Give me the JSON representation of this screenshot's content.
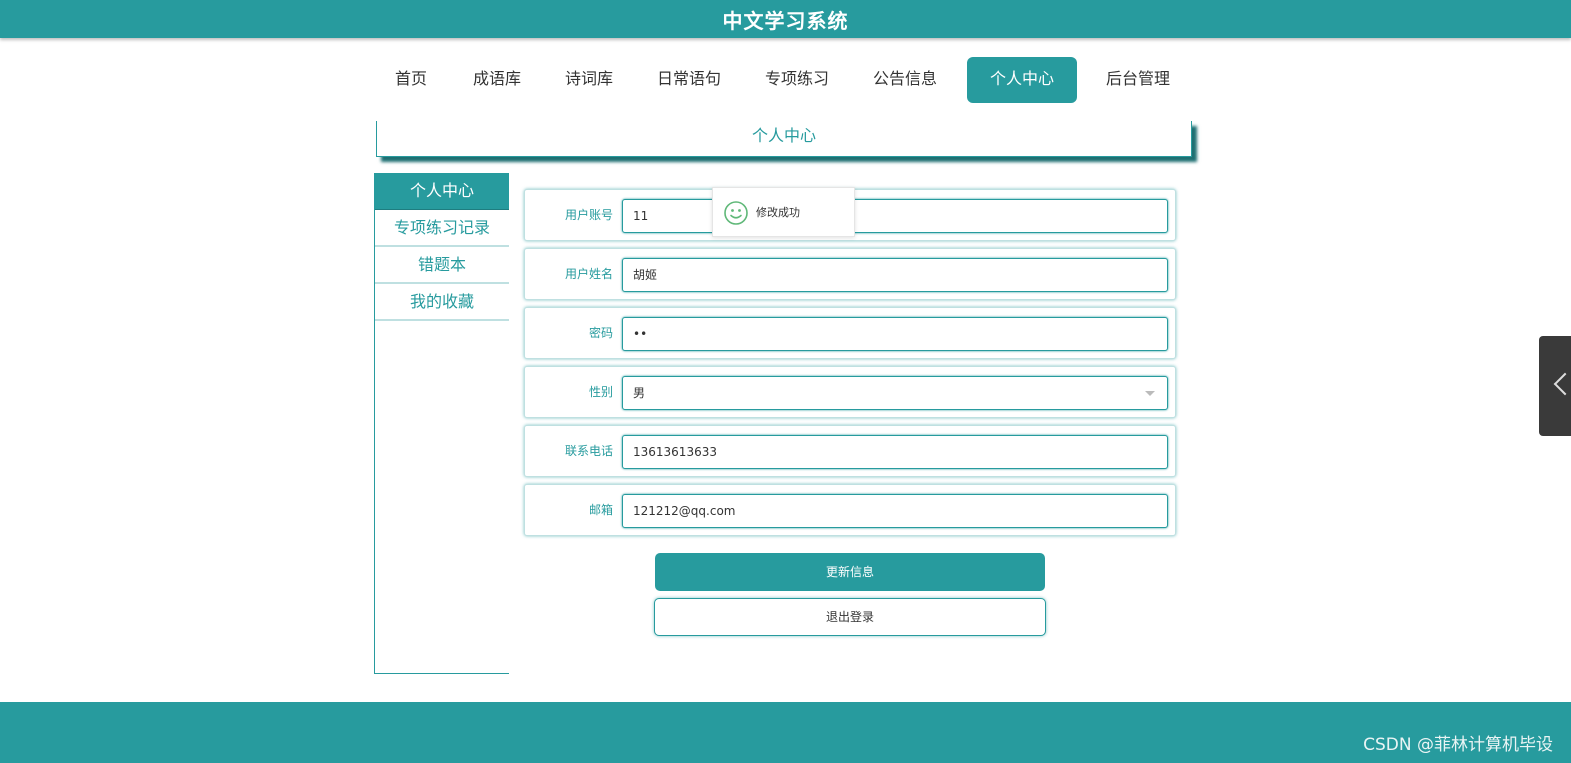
{
  "app": {
    "title": "中文学习系统"
  },
  "nav": {
    "items": [
      {
        "label": "首页"
      },
      {
        "label": "成语库"
      },
      {
        "label": "诗词库"
      },
      {
        "label": "日常语句"
      },
      {
        "label": "专项练习"
      },
      {
        "label": "公告信息"
      },
      {
        "label": "个人中心",
        "active": true
      },
      {
        "label": "后台管理"
      }
    ]
  },
  "page": {
    "heading": "个人中心"
  },
  "sidebar": {
    "items": [
      {
        "label": "个人中心",
        "active": true
      },
      {
        "label": "专项练习记录"
      },
      {
        "label": "错题本"
      },
      {
        "label": "我的收藏"
      }
    ]
  },
  "form": {
    "account": {
      "label": "用户账号",
      "value": "11"
    },
    "name": {
      "label": "用户姓名",
      "value": "胡姬"
    },
    "password": {
      "label": "密码",
      "value": "••"
    },
    "gender": {
      "label": "性别",
      "value": "男"
    },
    "phone": {
      "label": "联系电话",
      "value": "13613613633"
    },
    "email": {
      "label": "邮箱",
      "value": "121212@qq.com"
    }
  },
  "buttons": {
    "update": "更新信息",
    "logout": "退出登录"
  },
  "toast": {
    "message": "修改成功"
  },
  "footer": {
    "watermark": "CSDN @菲林计算机毕设"
  },
  "colors": {
    "accent": "#279b9e",
    "dark_tab": "#3a3a3a"
  },
  "icons": {
    "toast": "smile-icon",
    "side_tab": "chevron-left-icon",
    "select": "caret-down-icon"
  }
}
